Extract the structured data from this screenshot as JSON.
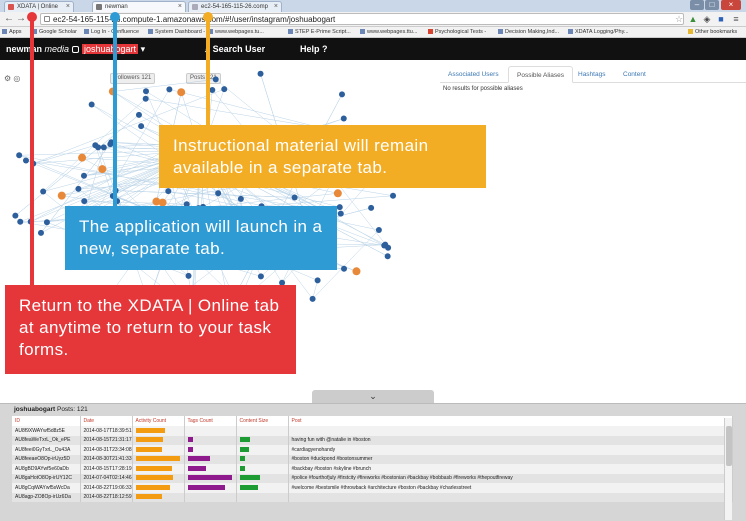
{
  "browser": {
    "tabs": [
      {
        "label": "XDATA | Online"
      },
      {
        "label": "newman"
      },
      {
        "label": "ec2-54-165-115-26.comp"
      }
    ],
    "url": "ec2-54-165-115-26.compute-1.amazonaws.com/#!/user/instagram/joshuabogart",
    "bookmarks": [
      "Apps",
      "Google Scholar",
      "Log In - Confluence",
      "System Dashboard -",
      "www.webpages.tu...",
      "STEP E-Prime Script...",
      "www.webpages.ttu...",
      "Psychological Tests -",
      "Decision Making,Ind...",
      "XDATA Logging/Phy...",
      "Other bookmarks"
    ]
  },
  "app": {
    "brand_bold": "newman",
    "brand_light": "media",
    "user": "joshuabogart",
    "search_user": "Search User",
    "help": "Help"
  },
  "graph": {
    "toolbar_pills": [
      "Followers 121",
      "Posts 121"
    ]
  },
  "right_panel": {
    "tabs": [
      "Associated Users",
      "Possible Aliases",
      "Hashtags",
      "Content"
    ],
    "active_tab": "Possible Aliases",
    "empty_message": "No results for possible aliases"
  },
  "callouts": {
    "yellow": "Instructional material will remain available in a separate tab.",
    "blue": "The application will launch in a new, separate tab.",
    "red": "Return to the XDATA | Online tab at anytime to return to your task forms."
  },
  "colors": {
    "yellow": "#f3ad25",
    "blue": "#2f9bd4",
    "red": "#e5363a",
    "orange_bar": "#f39c12",
    "purple_bar": "#8e1a8e",
    "green_bar": "#1e9c34"
  },
  "table": {
    "title_user": "joshuabogart",
    "title_suffix": "Posts: 121",
    "columns": [
      "ID",
      "Date",
      "Activity Count",
      "Tags Count",
      "Content Size",
      "Post"
    ],
    "rows": [
      {
        "id": "AU8f9XWAYwf5d8z5E",
        "date": "2014-08-17T18:39:51",
        "activity": 0.65,
        "tags": 0,
        "content": 0,
        "post": ""
      },
      {
        "id": "AU8feaWeTxrL_Ok_ePE",
        "date": "2014-08-15T21:31:17",
        "activity": 0.62,
        "tags": 0.12,
        "content": 0.22,
        "post": "having fun with @natalie in #boston"
      },
      {
        "id": "AU8feei0GyTxrL_Ou43A",
        "date": "2014-08-31T23:34:08",
        "activity": 0.6,
        "tags": 0.12,
        "content": 0.2,
        "post": "#cardiagyenohandy"
      },
      {
        "id": "AU8feeaeO8Op-irUyz5D",
        "date": "2014-08-30T21:41:33",
        "activity": 1.0,
        "tags": 0.5,
        "content": 0.12,
        "post": "#boston #duckpond #bostonsummer"
      },
      {
        "id": "AU8gBD9AYwf5e60aDb",
        "date": "2014-08-15T17:28:19",
        "activity": 0.82,
        "tags": 0.4,
        "content": 0.12,
        "post": "#backbay #boston #skyline #brunch"
      },
      {
        "id": "AU8gaHotO8Op-irUY12C",
        "date": "2014-07-04T02:14:46",
        "activity": 0.85,
        "tags": 1.0,
        "content": 0.45,
        "post": "#police #fourthofjuly #firstcity #fireworks #bostonian #backbay #bobbasb #fireworks #thepoutfireway"
      },
      {
        "id": "AU8gCqiWAYwf5sWcDa",
        "date": "2014-08-22T19:06:33",
        "activity": 0.78,
        "tags": 0.85,
        "content": 0.4,
        "post": "#welcome #bestsmile #throwback #architecture #boston #backbay #charlesstreet"
      },
      {
        "id": "AU8agp-ZO8Op-irUz6Da",
        "date": "2014-08-22T18:12:59",
        "activity": 0.6,
        "tags": 0,
        "content": 0,
        "post": ""
      }
    ]
  }
}
